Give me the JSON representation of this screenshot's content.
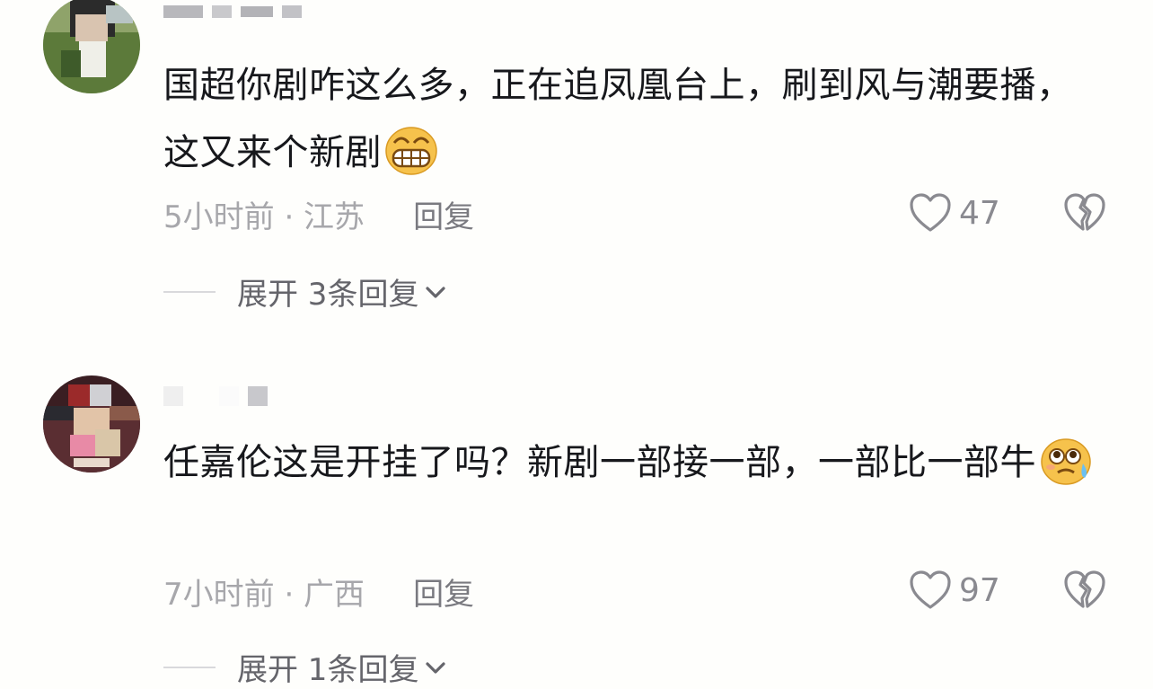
{
  "comments": [
    {
      "username": "",
      "text": "国超你剧咋这么多，正在追凤凰台上，刷到风与潮要播，这又来个新剧",
      "emoji": "grinning-face",
      "time_location": "5小时前 · 江苏",
      "reply_label": "回复",
      "like_count": "47",
      "expand_label": "展开 3条回复"
    },
    {
      "username": "",
      "text": "任嘉伦这是开挂了吗？新剧一部接一部，一部比一部牛",
      "emoji": "flushed-sweat-face",
      "time_location": "7小时前 · 广西",
      "reply_label": "回复",
      "like_count": "97",
      "expand_label": "展开 1条回复"
    }
  ],
  "colors": {
    "background": "#fefefc",
    "text": "#17181c",
    "meta": "#a7a7ab",
    "reply": "#7a7a80",
    "icon": "#8a8a90"
  }
}
